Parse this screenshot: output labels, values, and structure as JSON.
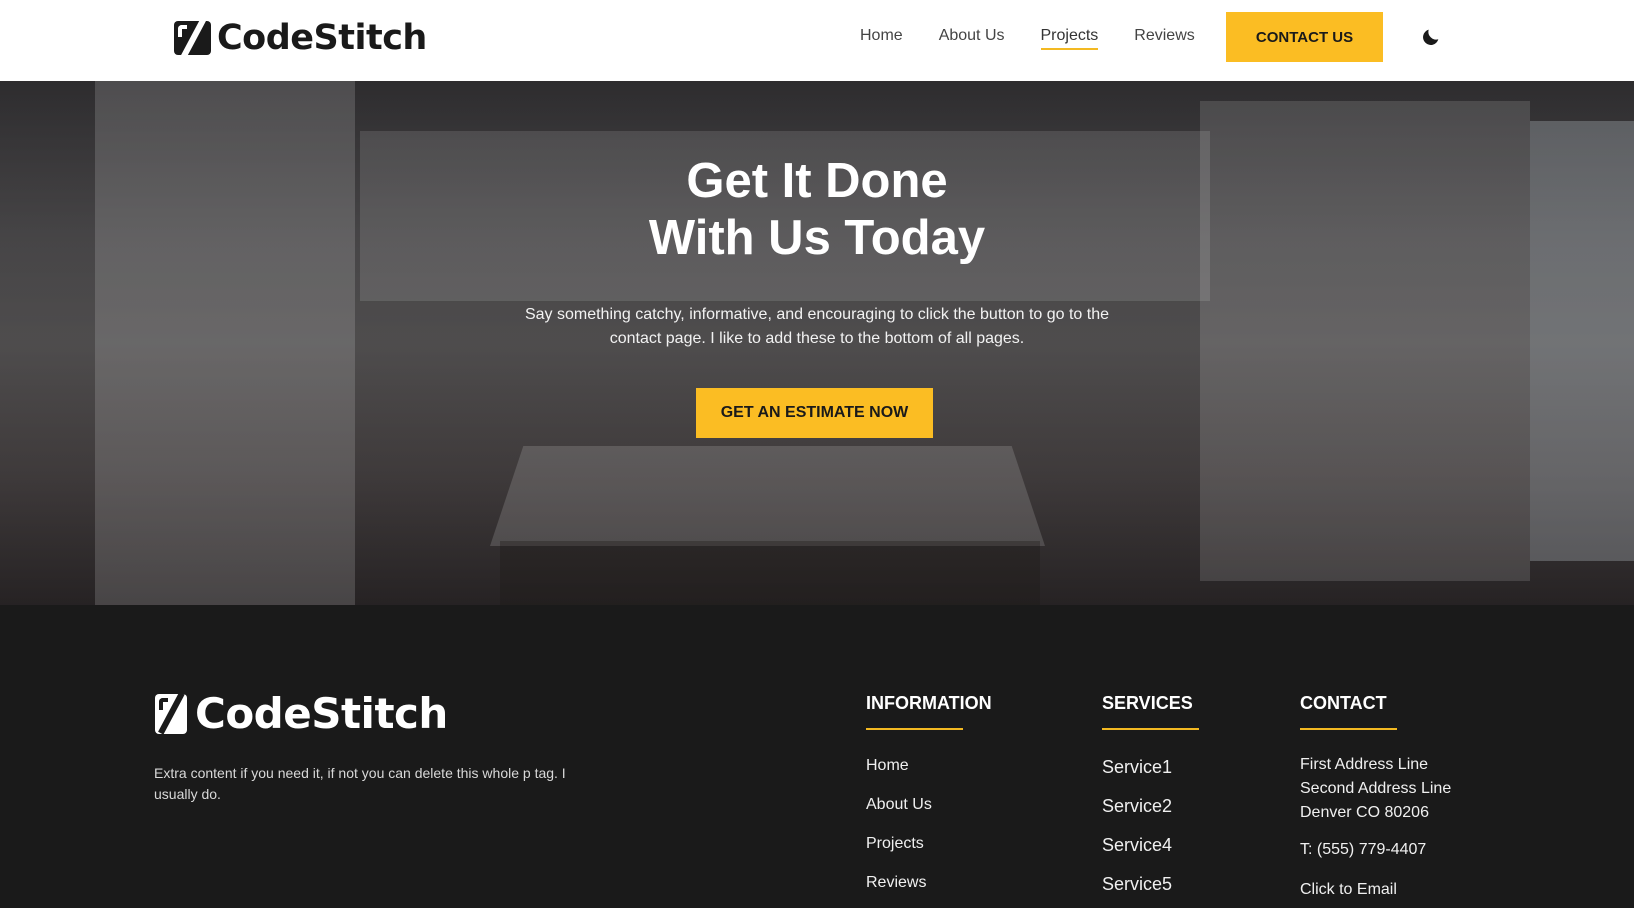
{
  "header": {
    "logo_text": "CodeStitch",
    "nav": [
      {
        "label": "Home"
      },
      {
        "label": "About Us"
      },
      {
        "label": "Projects",
        "active": true
      },
      {
        "label": "Reviews"
      }
    ],
    "cta_label": "CONTACT US",
    "theme_toggle_icon": "moon-icon"
  },
  "hero": {
    "title_line1": "Get It Done",
    "title_line2": "With Us Today",
    "subtitle": "Say something catchy, informative, and encouraging to click the button to go to the contact page. I like to add these to the bottom of all pages.",
    "cta_label": "GET AN ESTIMATE NOW"
  },
  "footer": {
    "logo_text": "CodeStitch",
    "blurb": "Extra content if you need it, if not you can delete this whole p tag. I usually do.",
    "information": {
      "heading": "INFORMATION",
      "links": [
        "Home",
        "About Us",
        "Projects",
        "Reviews"
      ]
    },
    "services": {
      "heading": "SERVICES",
      "links": [
        "Service1",
        "Service2",
        "Service4",
        "Service5"
      ]
    },
    "contact": {
      "heading": "CONTACT",
      "address_line1": "First Address Line",
      "address_line2": "Second Address Line",
      "address_line3": "Denver CO 80206",
      "phone": "T: (555) 779-4407",
      "email": "Click to Email"
    }
  },
  "colors": {
    "accent": "#fbbd23",
    "dark": "#1a1a1a",
    "white": "#ffffff"
  }
}
